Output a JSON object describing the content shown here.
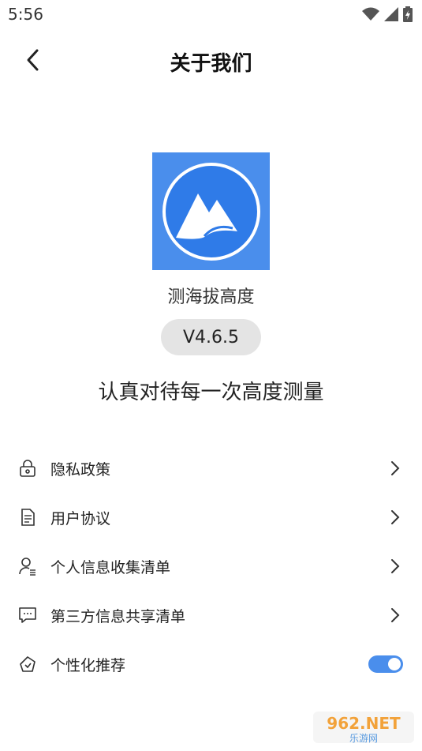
{
  "status_bar": {
    "time": "5:56"
  },
  "header": {
    "title": "关于我们"
  },
  "app": {
    "name": "测海拔高度",
    "version": "V4.6.5",
    "slogan": "认真对待每一次高度测量"
  },
  "menu": {
    "items": [
      {
        "label": "隐私政策",
        "icon": "lock-icon"
      },
      {
        "label": "用户协议",
        "icon": "document-icon"
      },
      {
        "label": "个人信息收集清单",
        "icon": "user-list-icon"
      },
      {
        "label": "第三方信息共享清单",
        "icon": "chat-icon"
      },
      {
        "label": "个性化推荐",
        "icon": "recommend-icon",
        "toggle": true
      }
    ]
  },
  "watermark": {
    "brand": "962.NET",
    "sub": "乐游网"
  },
  "colors": {
    "accent": "#4a8eec",
    "pill": "#e4e4e4"
  }
}
